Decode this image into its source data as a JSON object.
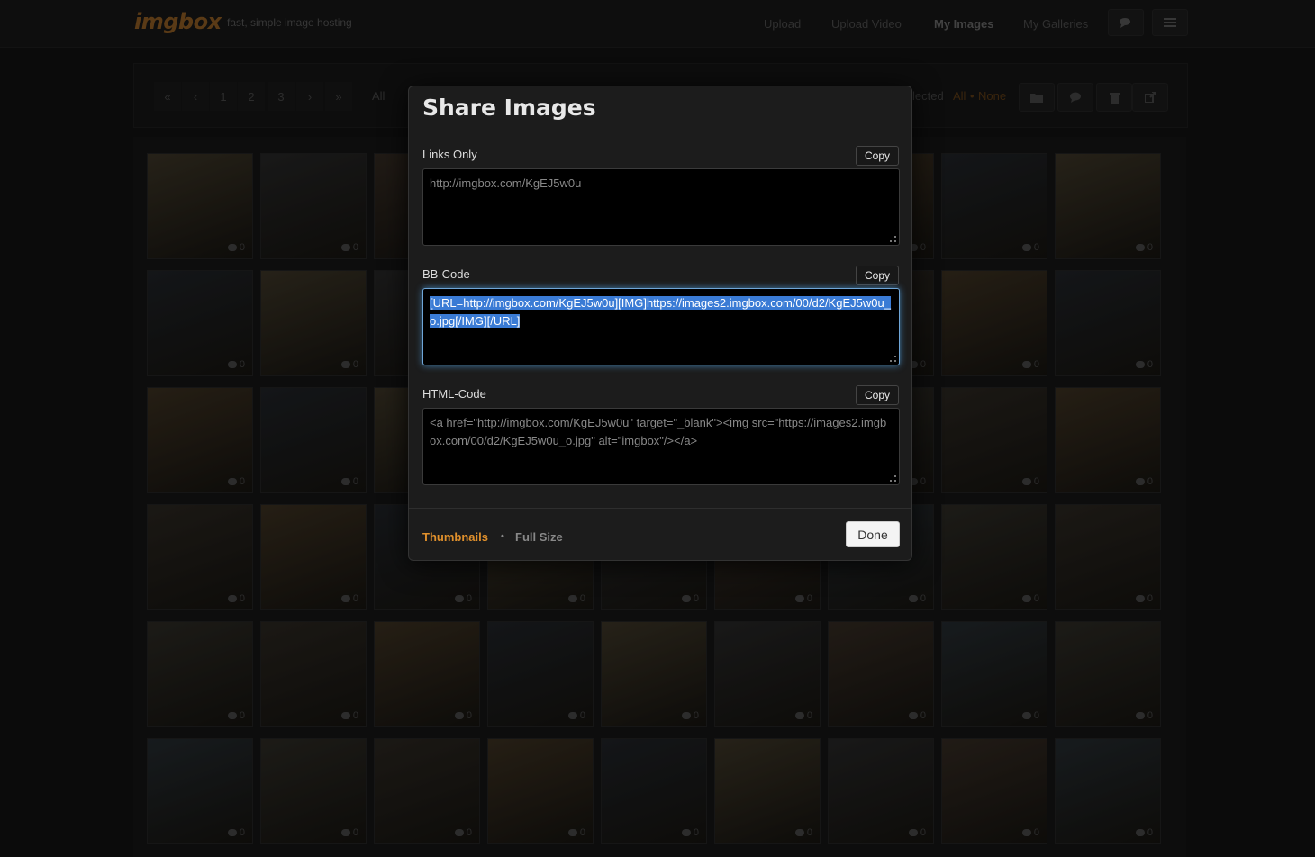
{
  "header": {
    "logo": "imgbox",
    "tagline": "fast, simple image hosting",
    "nav": [
      "Upload",
      "Upload Video",
      "My Images",
      "My Galleries"
    ],
    "active_nav": "My Images",
    "icons": [
      "chat-icon",
      "menu-icon"
    ]
  },
  "toolbar": {
    "pagination": [
      "«",
      "‹",
      "1",
      "2",
      "3",
      "›",
      "»"
    ],
    "filter_label": "All",
    "selected_label": "lected",
    "select_all": "All",
    "select_sep": "•",
    "select_none": "None",
    "action_icons": [
      "folder-icon",
      "comment-icon",
      "trash-icon",
      "share-icon"
    ]
  },
  "gallery": {
    "comment_count": "0"
  },
  "modal": {
    "title": "Share Images",
    "sections": [
      {
        "label": "Links Only",
        "copy_label": "Copy",
        "value": "http://imgbox.com/KgEJ5w0u"
      },
      {
        "label": "BB-Code",
        "copy_label": "Copy",
        "value": "[URL=http://imgbox.com/KgEJ5w0u][IMG]https://images2.imgbox.com/00/d2/KgEJ5w0u_o.jpg[/IMG][/URL]"
      },
      {
        "label": "HTML-Code",
        "copy_label": "Copy",
        "value": "<a href=\"http://imgbox.com/KgEJ5w0u\" target=\"_blank\"><img src=\"https://images2.imgbox.com/00/d2/KgEJ5w0u_o.jpg\" alt=\"imgbox\"/></a>"
      }
    ],
    "footer": {
      "thumbnails": "Thumbnails",
      "separator": "•",
      "full_size": "Full Size",
      "done": "Done"
    },
    "colors": {
      "active_size": "#e0902c",
      "focus_glow": "#52a8ec",
      "selection": "#3a7bd5"
    }
  }
}
